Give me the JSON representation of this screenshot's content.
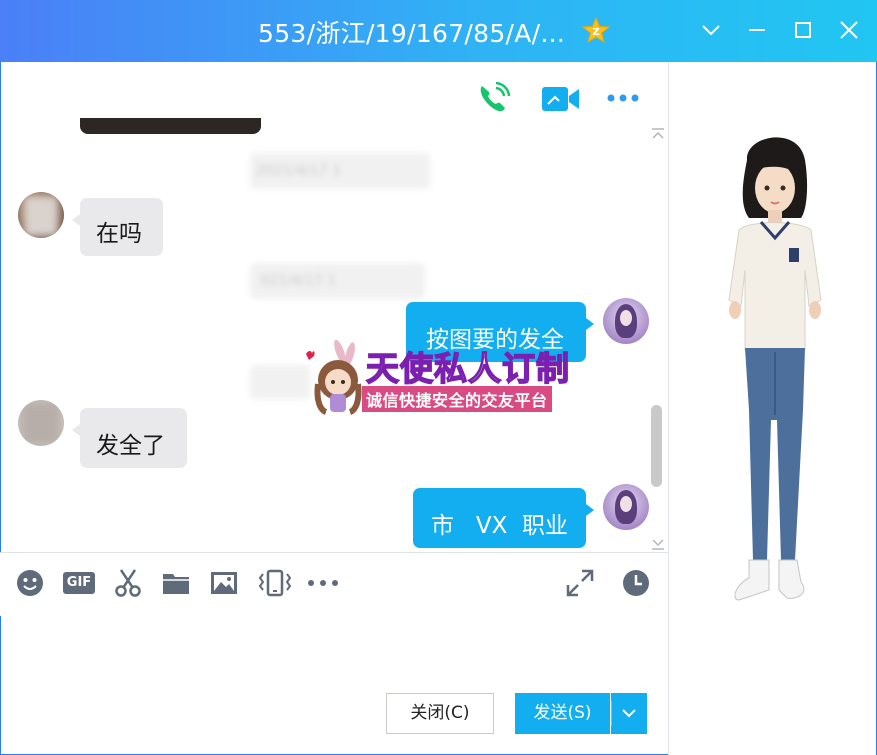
{
  "window": {
    "title": "553/浙江/19/167/85/A/...",
    "controls": [
      "chevron-down-icon",
      "minimize-icon",
      "maximize-icon",
      "close-icon"
    ]
  },
  "chat_toolbar_top": {
    "icons": [
      "voice-call-icon",
      "video-call-icon",
      "more-icon"
    ]
  },
  "messages": [
    {
      "side": "left",
      "text": "在吗"
    },
    {
      "side": "right",
      "text": "按图要的发全"
    },
    {
      "side": "left",
      "text": "发全了"
    },
    {
      "side": "right",
      "text": "市   VX  职业"
    }
  ],
  "blurred_timestamps": [
    "2021/4/17 1",
    "021/4/17 1"
  ],
  "watermark": {
    "title": "天使私人订制",
    "subtitle": "诚信快捷安全的交友平台"
  },
  "input_toolbar": {
    "icons": [
      "emoji-icon",
      "gif-icon",
      "scissors-icon",
      "folder-icon",
      "image-icon",
      "shake-icon",
      "more-icon",
      "expand-icon",
      "history-icon"
    ],
    "gif_label": "GIF"
  },
  "buttons": {
    "close_label": "关闭(C)",
    "send_label": "发送(S)"
  },
  "colors": {
    "accent": "#13aef0",
    "title_gradient_start": "#4b7ff7",
    "title_gradient_end": "#21c6f2"
  }
}
